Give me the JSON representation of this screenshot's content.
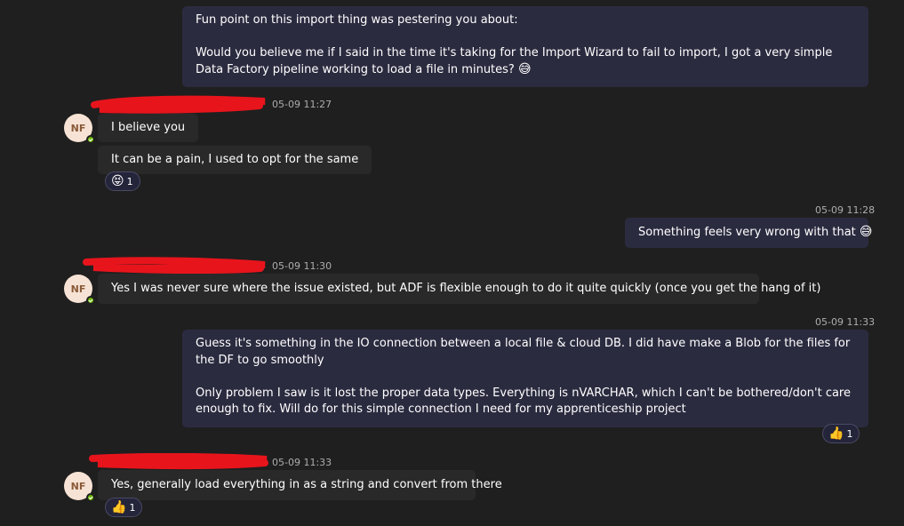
{
  "messages": {
    "m1": {
      "line1": "Fun point on this import thing was pestering you about:",
      "line2": "Would you believe me if I said in the time it's taking for the Import Wizard to fail to import, I got a very simple Data Factory pipeline working to load a file in minutes?",
      "emoji": "😅"
    },
    "m2": {
      "timestamp": "05-09 11:27",
      "avatar": "NF",
      "text1": "I believe you",
      "text2": "It can be a pain, I used to opt for the same",
      "reaction": {
        "emoji": "😝",
        "count": "1"
      }
    },
    "m3": {
      "timestamp": "05-09 11:28",
      "text": "Something feels very wrong with that",
      "emoji": "😅"
    },
    "m4": {
      "timestamp": "05-09 11:30",
      "avatar": "NF",
      "text": "Yes I was never sure where the issue existed, but ADF is flexible enough to do it quite quickly (once you get the hang of it)"
    },
    "m5": {
      "timestamp": "05-09 11:33",
      "para1": "Guess it's something in the IO connection between a local file & cloud DB. I did have make a Blob for the files for the DF to go smoothly",
      "para2": "Only problem I saw is it lost the proper data types. Everything is nVARCHAR, which I can't be bothered/don't care enough to fix. Will do for this simple connection I need for my apprenticeship project",
      "reaction": {
        "emoji": "👍",
        "count": "1"
      }
    },
    "m6": {
      "timestamp": "05-09 11:33",
      "avatar": "NF",
      "text": "Yes, generally load everything in as a string and convert from there",
      "reaction": {
        "emoji": "👍",
        "count": "1"
      }
    }
  },
  "colors": {
    "background": "#1f1f1f",
    "my_bubble": "#2b2b40",
    "other_bubble": "#292929",
    "redaction": "#e8141c",
    "presence": "#6bb700"
  }
}
